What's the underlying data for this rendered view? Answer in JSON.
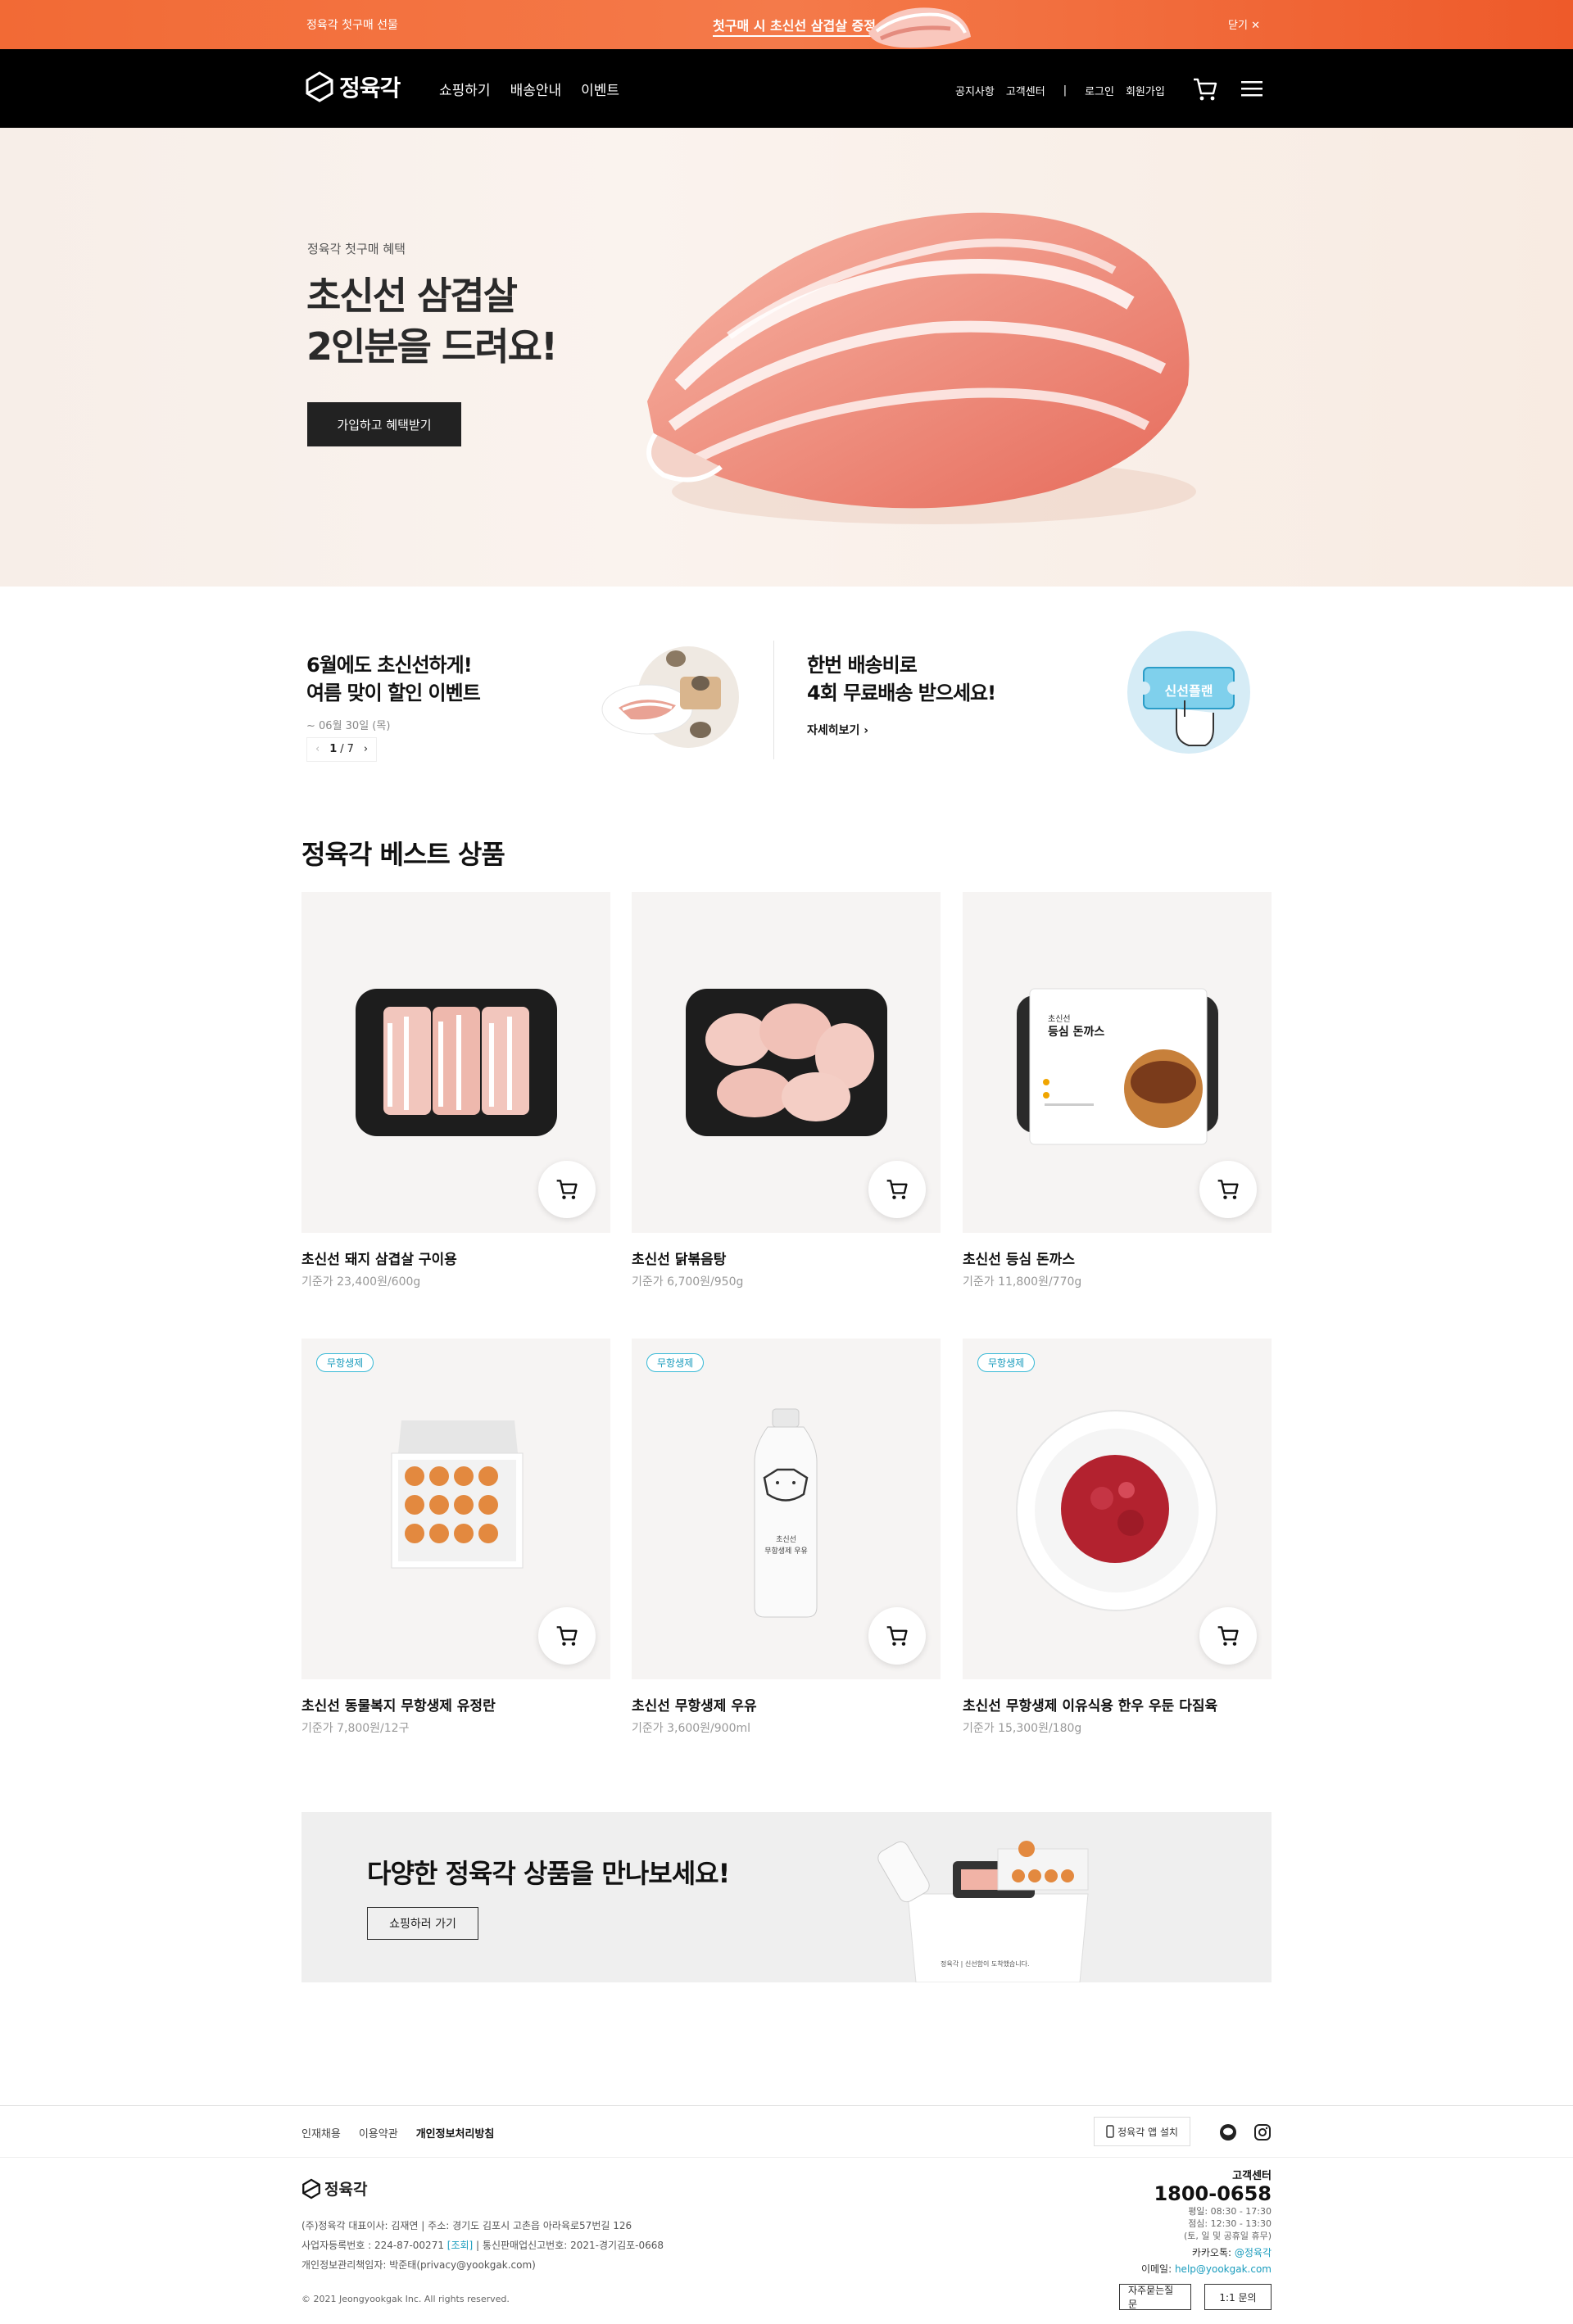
{
  "topbar": {
    "left_text": "정육각 첫구매 선물",
    "center_text": "첫구매 시 초신선 삼겹살 증정",
    "close_label": "닫기"
  },
  "nav": {
    "logo_text": "정육각",
    "menu": [
      "쇼핑하기",
      "배송안내",
      "이벤트"
    ],
    "util": [
      "공지사항",
      "고객센터",
      "|",
      "로그인",
      "회원가입"
    ]
  },
  "hero": {
    "sub": "정육각 첫구매 혜택",
    "line1": "초신선 삼겹살",
    "line2": "2인분을 드려요!",
    "button": "가입하고 혜택받기"
  },
  "promo1": {
    "line1": "6월에도 초신선하게!",
    "line2": "여름 맞이 할인 이벤트",
    "date": "~ 06월 30일 (목)",
    "pager": {
      "prev": "‹",
      "current": "1",
      "sep": "/",
      "total": "7",
      "next": "›"
    }
  },
  "promo2": {
    "line1": "한번 배송비로",
    "line2": "4회 무료배송 받으세요!",
    "more": "자세히보기",
    "ticket_text": "신선플랜"
  },
  "best": {
    "title": "정육각 베스트 상품",
    "products": [
      {
        "name": "초신선 돼지 삼겹살 구이용",
        "price": "기준가 23,400원/600g",
        "badge": ""
      },
      {
        "name": "초신선 닭볶음탕",
        "price": "기준가 6,700원/950g",
        "badge": ""
      },
      {
        "name": "초신선 등심 돈까스",
        "price": "기준가 11,800원/770g",
        "badge": "",
        "pack_title1": "초신선",
        "pack_title2": "등심 돈까스"
      },
      {
        "name": "초신선 동물복지 무항생제 유정란",
        "price": "기준가 7,800원/12구",
        "badge": "무항생제"
      },
      {
        "name": "초신선 무항생제 우유",
        "price": "기준가 3,600원/900ml",
        "badge": "무항생제",
        "bottle1": "초신선",
        "bottle2": "무항생제 우유"
      },
      {
        "name": "초신선 무항생제 이유식용 한우 우둔 다짐육",
        "price": "기준가 15,300원/180g",
        "badge": "무항생제"
      }
    ]
  },
  "banner2": {
    "title": "다양한 정육각 상품을 만나보세요!",
    "button": "쇼핑하러 가기",
    "bag_text": "정육각 | 신선함이 도착했습니다."
  },
  "footer": {
    "links": [
      "인재채용",
      "이용약관",
      "개인정보처리방침"
    ],
    "app_button": "정육각 앱 설치",
    "logo_text": "정육각",
    "info1": "(주)정육각   대표이사: 김재연   |   주소: 경기도 김포시 고촌읍 아라육로57번길 126",
    "info2a": "사업자등록번호 : 224-87-00271 ",
    "info2b": "[조회]",
    "info2c": "  |   통신판매업신고번호: 2021-경기김포-0668",
    "info3": "개인정보관리책임자: 박준태(privacy@yookgak.com)",
    "copyright": "© 2021 Jeongyookgak Inc. All rights reserved.",
    "cs_label": "고객센터",
    "cs_number": "1800-0658",
    "hours1": "평일: 08:30 - 17:30",
    "hours2": "점심: 12:30 - 13:30",
    "hours3": "(토, 일 및 공휴일 휴무)",
    "kakao_label": "카카오톡: ",
    "kakao_value": "@정육각",
    "email_label": "이메일: ",
    "email_value": "help@yookgak.com",
    "faq_button": "자주묻는질문",
    "inquiry_button": "1:1 문의"
  },
  "colors": {
    "accent": "#f26a35",
    "badge": "#38b9d6",
    "nav_bg": "#000000"
  }
}
